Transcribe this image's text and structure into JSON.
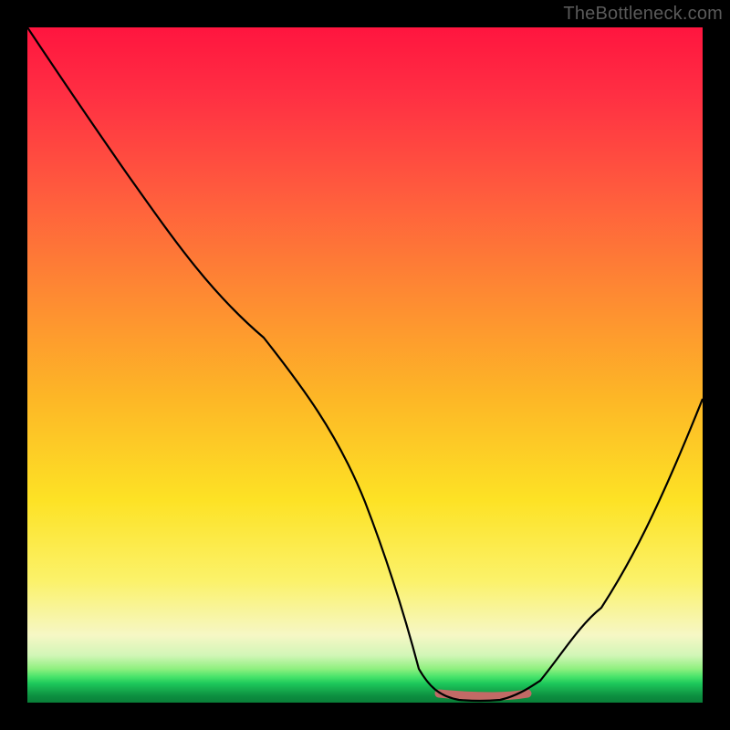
{
  "watermark": "TheBottleneck.com",
  "chart_data": {
    "type": "line",
    "title": "",
    "xlabel": "",
    "ylabel": "",
    "xlim": [
      0,
      100
    ],
    "ylim": [
      0,
      100
    ],
    "grid": false,
    "legend": false,
    "description": "Bottleneck percentage curve rendered over a vertical red-to-green gradient background. The curve descends smoothly from the upper-left corner, bottoms out near the right-center, and rises again toward the right edge. The y-axis represents bottleneck severity (top = 100% bottleneck / red, bottom = 0% / green). The flat pink segment marks the optimal balance region.",
    "series": [
      {
        "name": "bottleneck_pct",
        "x": [
          0,
          5,
          10,
          15,
          20,
          25,
          30,
          35,
          40,
          45,
          50,
          55,
          58,
          61,
          64,
          67,
          70,
          73,
          76,
          80,
          85,
          90,
          95,
          100
        ],
        "values": [
          100,
          93,
          86,
          78,
          70,
          62,
          54,
          46,
          38,
          29,
          20,
          10,
          5,
          2,
          1,
          0,
          0,
          1,
          3,
          7,
          14,
          23,
          33,
          45
        ]
      }
    ],
    "optimal_range_x": [
      61,
      73
    ],
    "background_gradient_stops": [
      {
        "pct": 0,
        "color": "#ff153f"
      },
      {
        "pct": 40,
        "color": "#fe8b32"
      },
      {
        "pct": 70,
        "color": "#fde225"
      },
      {
        "pct": 92,
        "color": "#eef8cf"
      },
      {
        "pct": 96,
        "color": "#47e36a"
      },
      {
        "pct": 100,
        "color": "#0a7f38"
      }
    ]
  }
}
